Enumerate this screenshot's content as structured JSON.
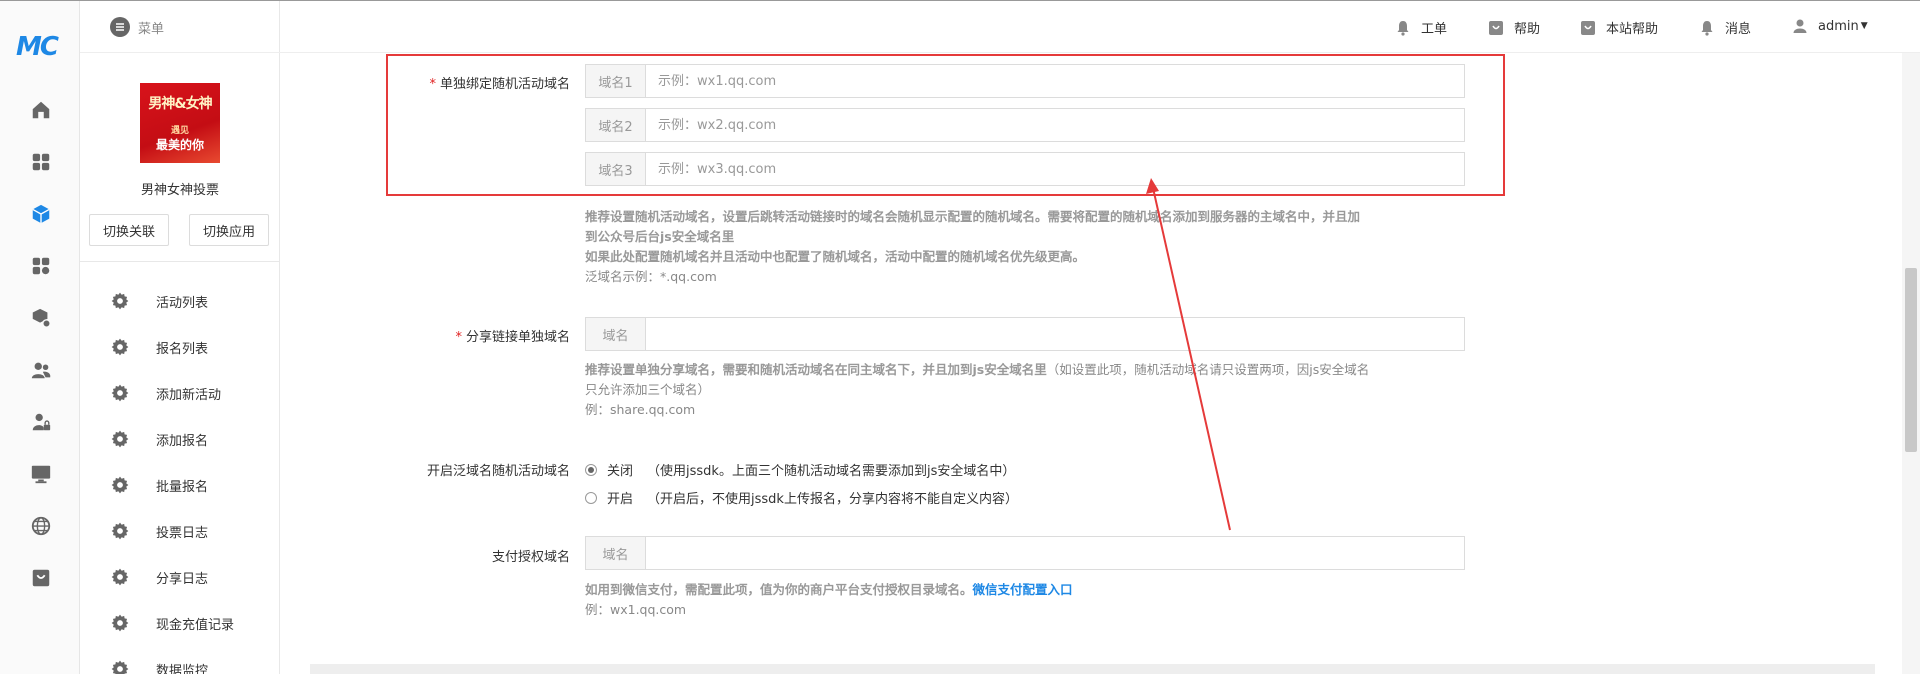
{
  "brand": {
    "logo_text": "MC"
  },
  "sidebar": {
    "menu_label": "菜单",
    "app": {
      "thumb_line1": "男神&女神",
      "thumb_line2": "遇见",
      "thumb_line3": "最美的你",
      "name": "男神女神投票"
    },
    "switch_related": "切换关联",
    "switch_app": "切换应用",
    "items": [
      {
        "label": "活动列表"
      },
      {
        "label": "报名列表"
      },
      {
        "label": "添加新活动"
      },
      {
        "label": "添加报名"
      },
      {
        "label": "批量报名"
      },
      {
        "label": "投票日志"
      },
      {
        "label": "分享日志"
      },
      {
        "label": "现金充值记录"
      },
      {
        "label": "数据监控"
      }
    ]
  },
  "topbar": {
    "ticket": "工单",
    "help": "帮助",
    "site_help": "本站帮助",
    "messages": "消息",
    "user": "admin"
  },
  "form": {
    "random_domain": {
      "label": "单独绑定随机活动域名",
      "required": "*",
      "fields": [
        {
          "addon": "域名1",
          "placeholder": "示例：wx1.qq.com"
        },
        {
          "addon": "域名2",
          "placeholder": "示例：wx2.qq.com"
        },
        {
          "addon": "域名3",
          "placeholder": "示例：wx3.qq.com"
        }
      ],
      "help_line1": "推荐设置随机活动域名，设置后跳转活动链接时的域名会随机显示配置的随机域名。需要将配置的随机域名添加到服务器的主域名中，并且加",
      "help_line2": "到公众号后台js安全域名里",
      "help_line3": "如果此处配置随机域名并且活动中也配置了随机域名，活动中配置的随机域名优先级更高。",
      "help_line4": "泛域名示例：*.qq.com"
    },
    "share_domain": {
      "label": "分享链接单独域名",
      "required": "*",
      "addon": "域名",
      "help_bold": "推荐设置单独分享域名，需要和随机活动域名在同主域名下，并且加到js安全域名里",
      "help_rest": "（如设置此项，随机活动域名请只设置两项，因js安全域名",
      "help_line2": "只允许添加三个域名）",
      "help_line3": "例：share.qq.com"
    },
    "wildcard": {
      "label": "开启泛域名随机活动域名",
      "options": [
        {
          "label": "关闭",
          "desc": "（使用jssdk。上面三个随机活动域名需要添加到js安全域名中）",
          "checked": true
        },
        {
          "label": "开启",
          "desc": "（开启后，不使用jssdk上传报名，分享内容将不能自定义内容）",
          "checked": false
        }
      ]
    },
    "pay_domain": {
      "label": "支付授权域名",
      "addon": "域名",
      "help_text": "如用到微信支付，需配置此项，值为你的商户平台支付授权目录域名。",
      "help_link": "微信支付配置入口",
      "help_line2": "例：wx1.qq.com"
    }
  },
  "colors": {
    "accent": "#1e88e5",
    "highlight": "#e53a3a"
  }
}
